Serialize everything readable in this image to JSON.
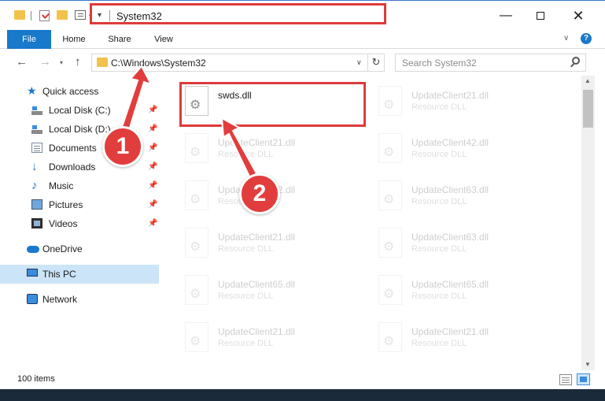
{
  "window": {
    "title": "System32",
    "minimize_glyph": "—",
    "close_glyph": "✕"
  },
  "ribbon": {
    "tabs": [
      {
        "label": "File"
      },
      {
        "label": "Home"
      },
      {
        "label": "Share"
      },
      {
        "label": "View"
      }
    ]
  },
  "address_bar": {
    "path": "C:\\Windows\\System32",
    "search_placeholder": "Search System32"
  },
  "nav_pane": {
    "items": [
      {
        "label": "Quick access",
        "icon": "star-icon"
      },
      {
        "label": "Local Disk (C:)",
        "icon": "disk-icon",
        "pinned": true
      },
      {
        "label": "Local Disk (D:)",
        "icon": "disk-icon",
        "pinned": true
      },
      {
        "label": "Documents",
        "icon": "documents-icon",
        "pinned": true
      },
      {
        "label": "Downloads",
        "icon": "downloads-icon",
        "pinned": true
      },
      {
        "label": "Music",
        "icon": "music-icon",
        "pinned": true
      },
      {
        "label": "Pictures",
        "icon": "pictures-icon",
        "pinned": true
      },
      {
        "label": "Videos",
        "icon": "videos-icon",
        "pinned": true
      },
      {
        "label": "OneDrive",
        "icon": "cloud-icon"
      },
      {
        "label": "This PC",
        "icon": "computer-icon",
        "selected": true
      },
      {
        "label": "Network",
        "icon": "network-icon"
      }
    ]
  },
  "files": [
    {
      "name": "swds.dll",
      "type": ""
    },
    {
      "name": "UpdateClient21.dll",
      "type": "Resource DLL"
    },
    {
      "name": "UpdateClient21.dll",
      "type": "Resource DLL"
    },
    {
      "name": "UpdateClient42.dll",
      "type": "Resource DLL"
    },
    {
      "name": "UpdateClient42.dll",
      "type": "Resource DLL"
    },
    {
      "name": "UpdateClient63.dll",
      "type": "Resource DLL"
    },
    {
      "name": "UpdateClient21.dll",
      "type": "Resource DLL"
    },
    {
      "name": "UpdateClient63.dll",
      "type": "Resource DLL"
    },
    {
      "name": "UpdateClient65.dll",
      "type": "Resource DLL"
    },
    {
      "name": "UpdateClient65.dll",
      "type": "Resource DLL"
    },
    {
      "name": "UpdateClient21.dll",
      "type": "Resource DLL"
    },
    {
      "name": "UpdateClient21.dll",
      "type": "Resource DLL"
    }
  ],
  "status": {
    "item_count": "100 items"
  },
  "annotations": {
    "step1": "1",
    "step2": "2"
  },
  "colors": {
    "accent": "#1979ca",
    "highlight_red": "#dd3b3b",
    "selected_bg": "#cce4f7"
  }
}
